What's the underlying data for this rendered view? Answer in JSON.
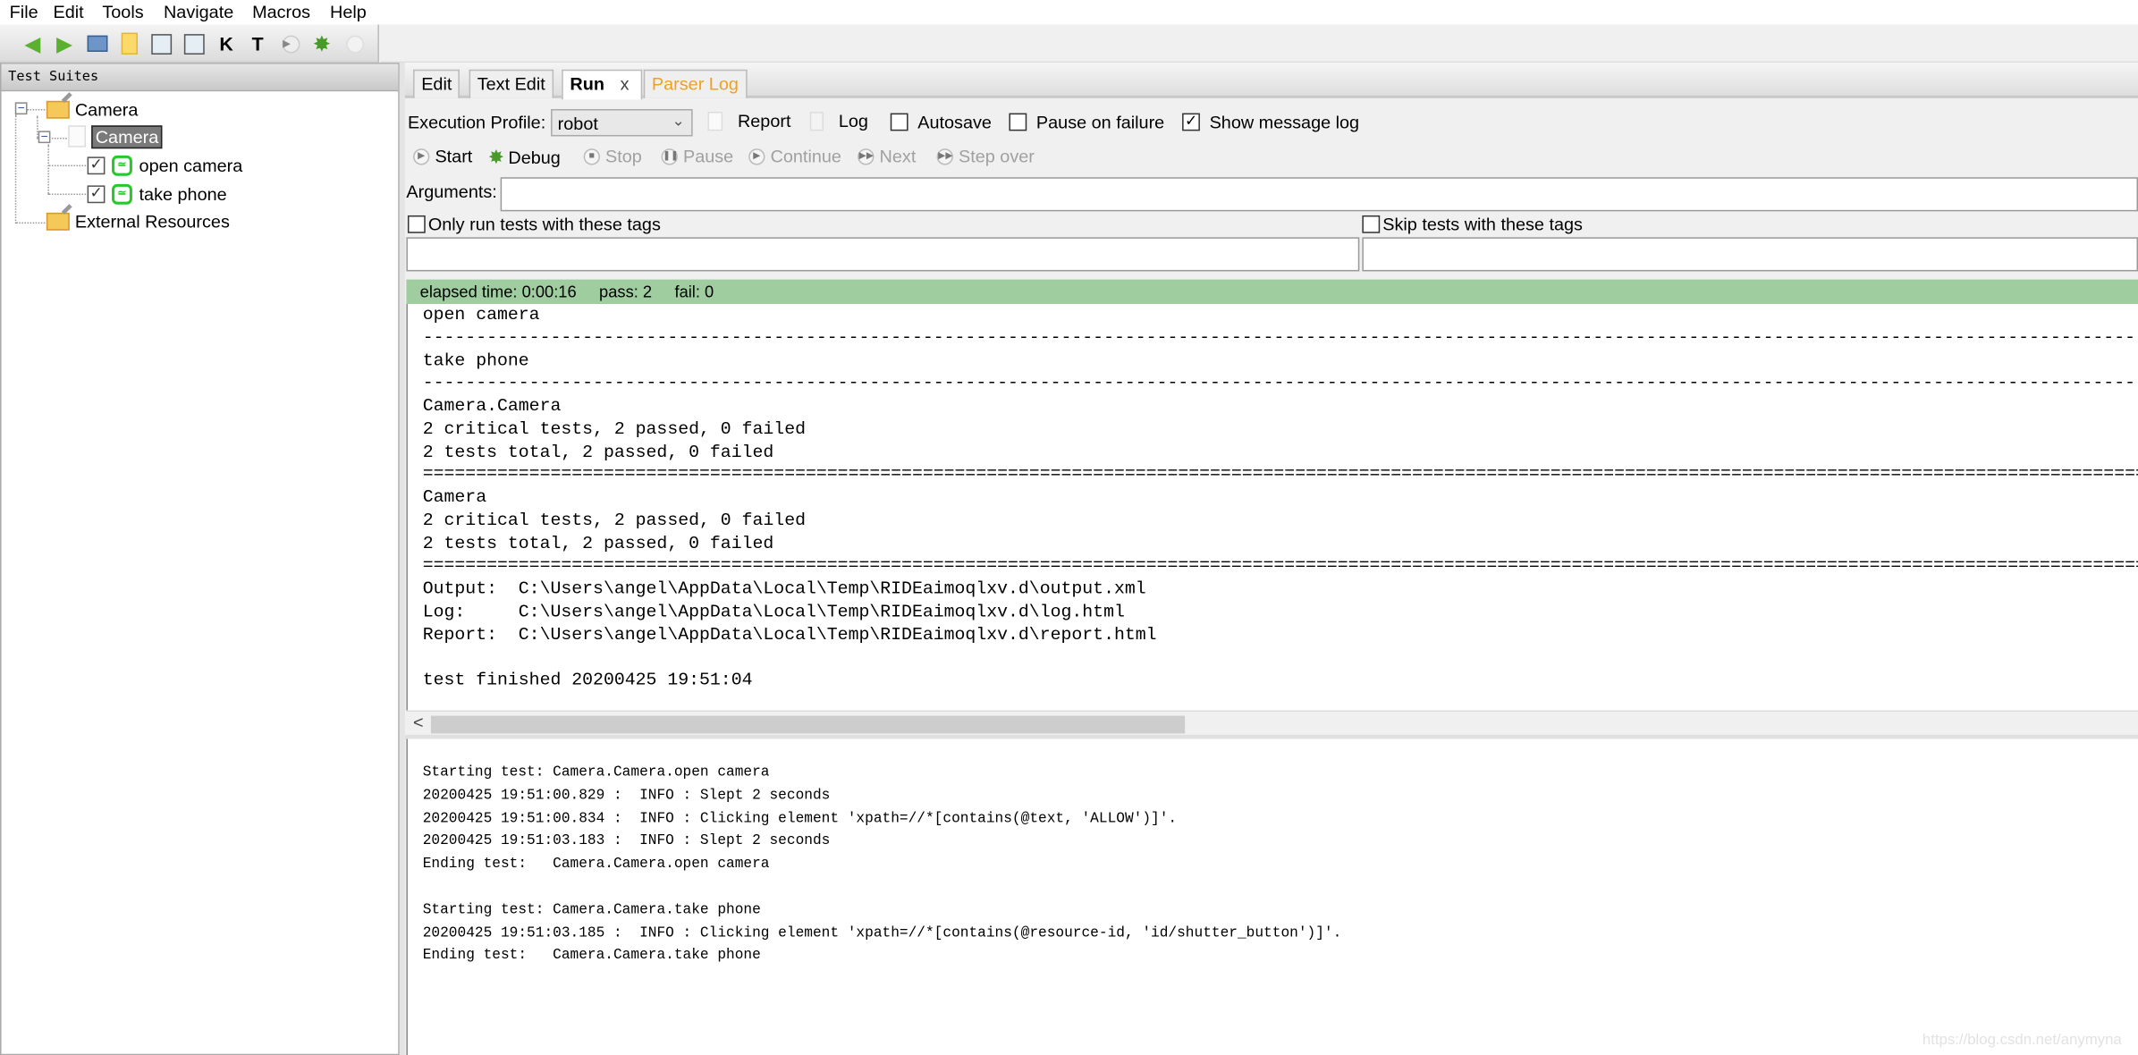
{
  "menu": [
    "File",
    "Edit",
    "Tools",
    "Navigate",
    "Macros",
    "Help"
  ],
  "toolbar": {
    "icons": [
      "go-back-icon",
      "go-forward-icon",
      "open-icon",
      "folder-icon",
      "save-icon",
      "save-all-icon",
      "search-keywords-icon",
      "search-tests-icon",
      "run-icon",
      "debug-icon",
      "stop-icon"
    ],
    "keyword_glyph": "K",
    "test_glyph": "T"
  },
  "left_panel": {
    "header": "Test Suites",
    "tree": [
      {
        "label": "Camera",
        "type": "suite-dir"
      },
      {
        "label": "Camera",
        "type": "suite-file",
        "selected": true
      },
      {
        "label": "open camera",
        "type": "test",
        "checked": true
      },
      {
        "label": "take phone",
        "type": "test",
        "checked": true
      },
      {
        "label": "External Resources",
        "type": "resources"
      }
    ]
  },
  "tabs": [
    {
      "label": "Edit"
    },
    {
      "label": "Text Edit"
    },
    {
      "label": "Run",
      "active": true,
      "close": "x"
    },
    {
      "label": "Parser Log",
      "color": "#f0a020"
    }
  ],
  "run": {
    "profile_label": "Execution Profile:",
    "profile_value": "robot",
    "report": "Report",
    "log": "Log",
    "autosave": {
      "label": "Autosave",
      "checked": false
    },
    "pause_on_failure": {
      "label": "Pause on failure",
      "checked": false
    },
    "show_message_log": {
      "label": "Show message log",
      "checked": true
    },
    "check_mark": "✓",
    "buttons": [
      {
        "label": "Start",
        "enabled": true
      },
      {
        "label": "Debug",
        "enabled": true
      },
      {
        "label": "Stop",
        "enabled": false
      },
      {
        "label": "Pause",
        "enabled": false
      },
      {
        "label": "Continue",
        "enabled": false
      },
      {
        "label": "Next",
        "enabled": false
      },
      {
        "label": "Step over",
        "enabled": false
      }
    ],
    "arguments_label": "Arguments:",
    "arguments_value": "",
    "only_tags": {
      "label": "Only run tests with these tags",
      "checked": false,
      "value": ""
    },
    "skip_tags": {
      "label": "Skip tests with these tags",
      "checked": false,
      "value": ""
    }
  },
  "status": {
    "text": "elapsed time: 0:00:16     pass: 2     fail: 0",
    "color": "#9fcd9f"
  },
  "output_lines": [
    "open camera",
    "------------------------------------------------------------------------------------------------------------------------------------------------------------------------------",
    "take phone",
    "------------------------------------------------------------------------------------------------------------------------------------------------------------------------------",
    "Camera.Camera",
    "2 critical tests, 2 passed, 0 failed",
    "2 tests total, 2 passed, 0 failed",
    "==============================================================================================================================================================================",
    "Camera",
    "2 critical tests, 2 passed, 0 failed",
    "2 tests total, 2 passed, 0 failed",
    "==============================================================================================================================================================================",
    "Output:  C:\\Users\\angel\\AppData\\Local\\Temp\\RIDEaimoqlxv.d\\output.xml",
    "Log:     C:\\Users\\angel\\AppData\\Local\\Temp\\RIDEaimoqlxv.d\\log.html",
    "Report:  C:\\Users\\angel\\AppData\\Local\\Temp\\RIDEaimoqlxv.d\\report.html",
    "",
    "test finished 20200425 19:51:04"
  ],
  "scroll_left": "<",
  "message_lines": [
    "Starting test: Camera.Camera.open camera",
    "20200425 19:51:00.829 :  INFO : Slept 2 seconds",
    "20200425 19:51:00.834 :  INFO : Clicking element 'xpath=//*[contains(@text, 'ALLOW')]'.",
    "20200425 19:51:03.183 :  INFO : Slept 2 seconds",
    "Ending test:   Camera.Camera.open camera",
    "",
    "Starting test: Camera.Camera.take phone",
    "20200425 19:51:03.185 :  INFO : Clicking element 'xpath=//*[contains(@resource-id, 'id/shutter_button')]'.",
    "Ending test:   Camera.Camera.take phone"
  ],
  "watermark": "https://blog.csdn.net/anymyna"
}
